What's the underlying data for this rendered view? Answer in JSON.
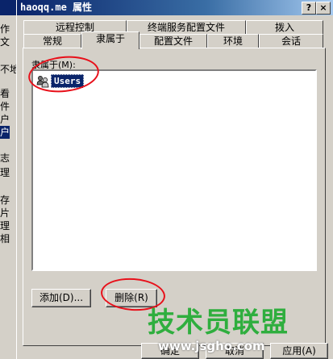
{
  "background_window": {
    "fragments": [
      "作",
      "文",
      "不地",
      "看",
      "件",
      "户",
      "户",
      "志",
      "理",
      "存",
      "片",
      "理",
      "相"
    ]
  },
  "dialog": {
    "title": "haoqq.me 属性",
    "help_label": "?",
    "close_label": "×",
    "tabs_back": [
      "远程控制",
      "终端服务配置文件",
      "拨入"
    ],
    "tabs_front": [
      "常规",
      "隶属于",
      "配置文件",
      "环境",
      "会话"
    ],
    "active_tab": "隶属于",
    "member_of_label": "隶属于(M):",
    "members": [
      {
        "name": "Users",
        "icon": "user-group-icon"
      }
    ],
    "add_button": "添加(D)...",
    "remove_button": "删除(R)",
    "bottom_buttons": [
      "确定",
      "取消",
      "应用(A)"
    ]
  },
  "watermark": {
    "text": "技术员联盟",
    "url": "www.jsgho.com"
  },
  "colors": {
    "title_bar": "#0a246a",
    "dialog_face": "#d4d0c8",
    "selection": "#0a246a",
    "annotation": "#e8101a",
    "watermark": "#2fae3e"
  }
}
